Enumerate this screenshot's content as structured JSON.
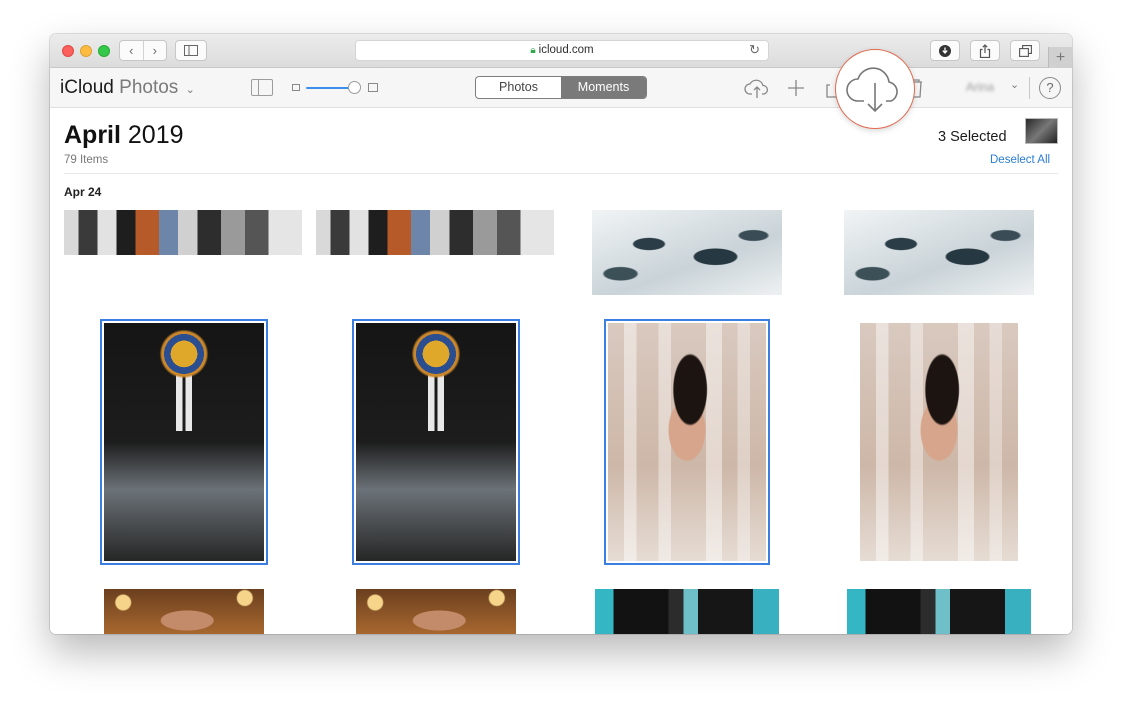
{
  "browser": {
    "url": "icloud.com",
    "back_glyph": "‹",
    "forward_glyph": "›",
    "reload_glyph": "↻",
    "newtab_glyph": "+"
  },
  "app": {
    "brand": "iCloud",
    "section": "Photos",
    "section_chevron": "⌄",
    "segments": [
      "Photos",
      "Moments"
    ],
    "active_segment": "Moments",
    "user_chevron": "⌄",
    "help_glyph": "?"
  },
  "header": {
    "month": "April",
    "year": "2019",
    "item_count": "79 Items",
    "selected_text": "3 Selected",
    "deselect_label": "Deselect All"
  },
  "moment": {
    "day_label": "Apr 24",
    "photos": [
      {
        "name": "people-street-1",
        "kind": "people",
        "selected": false
      },
      {
        "name": "people-street-2",
        "kind": "people",
        "selected": false
      },
      {
        "name": "snowy-mountain-1",
        "kind": "snow",
        "selected": false
      },
      {
        "name": "snowy-mountain-2",
        "kind": "snow",
        "selected": false
      },
      {
        "name": "church-staircase-1",
        "kind": "church",
        "selected": true
      },
      {
        "name": "church-staircase-2",
        "kind": "church",
        "selected": true
      },
      {
        "name": "glass-portrait-1",
        "kind": "glass",
        "selected": true
      },
      {
        "name": "glass-portrait-2",
        "kind": "glass",
        "selected": false
      },
      {
        "name": "woman-portrait-1",
        "kind": "woman",
        "selected": false
      },
      {
        "name": "woman-portrait-2",
        "kind": "woman",
        "selected": false
      },
      {
        "name": "teal-scene-1",
        "kind": "teal",
        "selected": false
      },
      {
        "name": "teal-scene-2",
        "kind": "teal",
        "selected": false
      }
    ]
  },
  "colors": {
    "accent": "#3b7fe0",
    "link": "#2a7ed6",
    "highlight_ring": "#e06a4f"
  },
  "icons": [
    "upload-cloud-icon",
    "add-icon",
    "download-cloud-icon",
    "trash-icon",
    "help-icon",
    "share-icon",
    "lock-icon"
  ]
}
